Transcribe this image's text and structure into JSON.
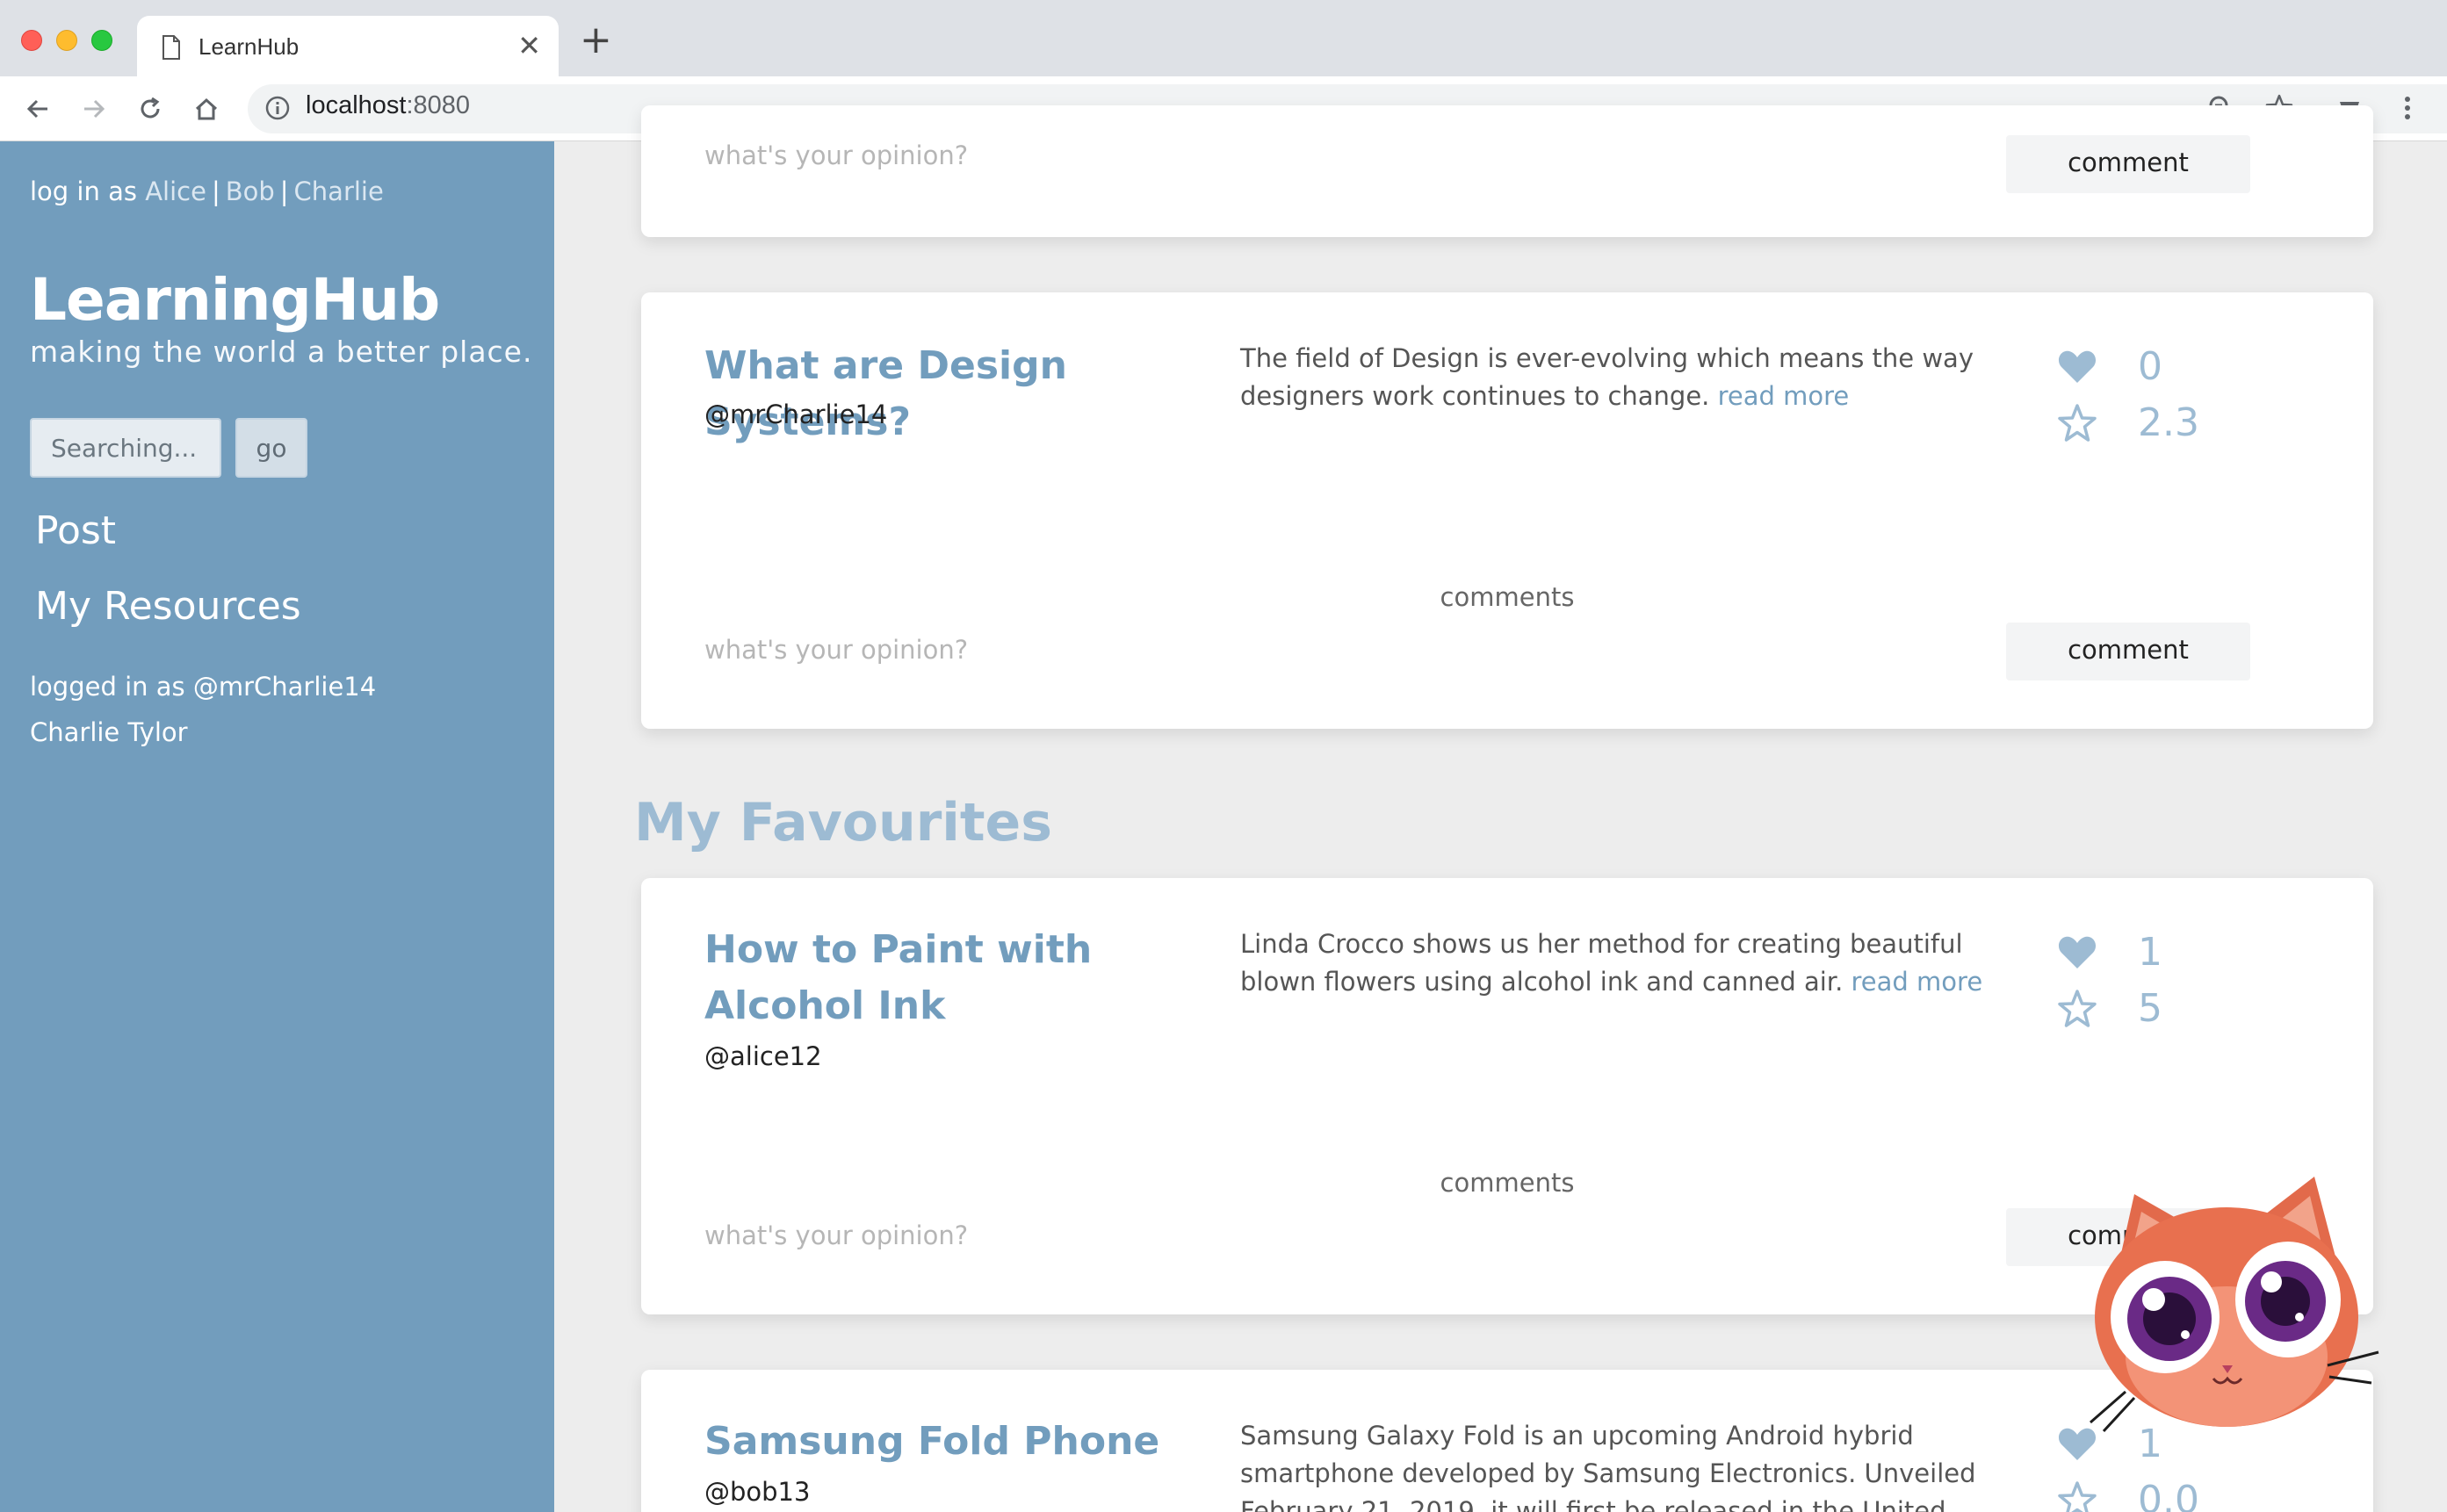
{
  "browser": {
    "tab_title": "LearnHub",
    "url_host": "localhost",
    "url_port": ":8080"
  },
  "sidebar": {
    "login_prefix": "log in as",
    "users": [
      "Alice",
      "Bob",
      "Charlie"
    ],
    "separator": "|",
    "brand": "LearningHub",
    "tagline": "making the world a better place.",
    "search_placeholder": "Searching...",
    "go_label": "go",
    "nav_post": "Post",
    "nav_resources": "My Resources",
    "logged_in_text": "logged in as @mrCharlie14",
    "full_name": "Charlie Tylor"
  },
  "main": {
    "top_card": {
      "opinion_placeholder": "what's your opinion?",
      "comment_label": "comment"
    },
    "design_card": {
      "title": "What are Design Systems?",
      "author": "@mrCharlie14",
      "description": "The field of Design is ever-evolving which means the way designers work continues to change.",
      "read_more": "read more",
      "likes": "0",
      "rating": "2.3",
      "comments_label": "comments",
      "opinion_placeholder": "what's your opinion?",
      "comment_label": "comment"
    },
    "favourites_heading": "My Favourites",
    "paint_card": {
      "title": "How to Paint with Alcohol Ink",
      "author": "@alice12",
      "description": "Linda Crocco shows us her method for creating beautiful blown flowers using alcohol ink and canned air.",
      "read_more": "read more",
      "likes": "1",
      "rating": "5",
      "comments_label": "comments",
      "opinion_placeholder": "what's your opinion?",
      "comment_label": "comment"
    },
    "samsung_card": {
      "title": "Samsung Fold Phone",
      "author": "@bob13",
      "description": "Samsung Galaxy Fold is an upcoming Android hybrid smartphone developed by Samsung Electronics. Unveiled February 21, 2019, it will first be released in the United States",
      "likes": "1",
      "rating": "0.0"
    }
  },
  "colors": {
    "sidebar_bg": "#729dbd",
    "accent": "#729dbd",
    "stat_color": "#9dbbd3",
    "page_bg": "#ededed"
  },
  "icons": {
    "like": "heart-icon",
    "rating": "star-icon"
  }
}
